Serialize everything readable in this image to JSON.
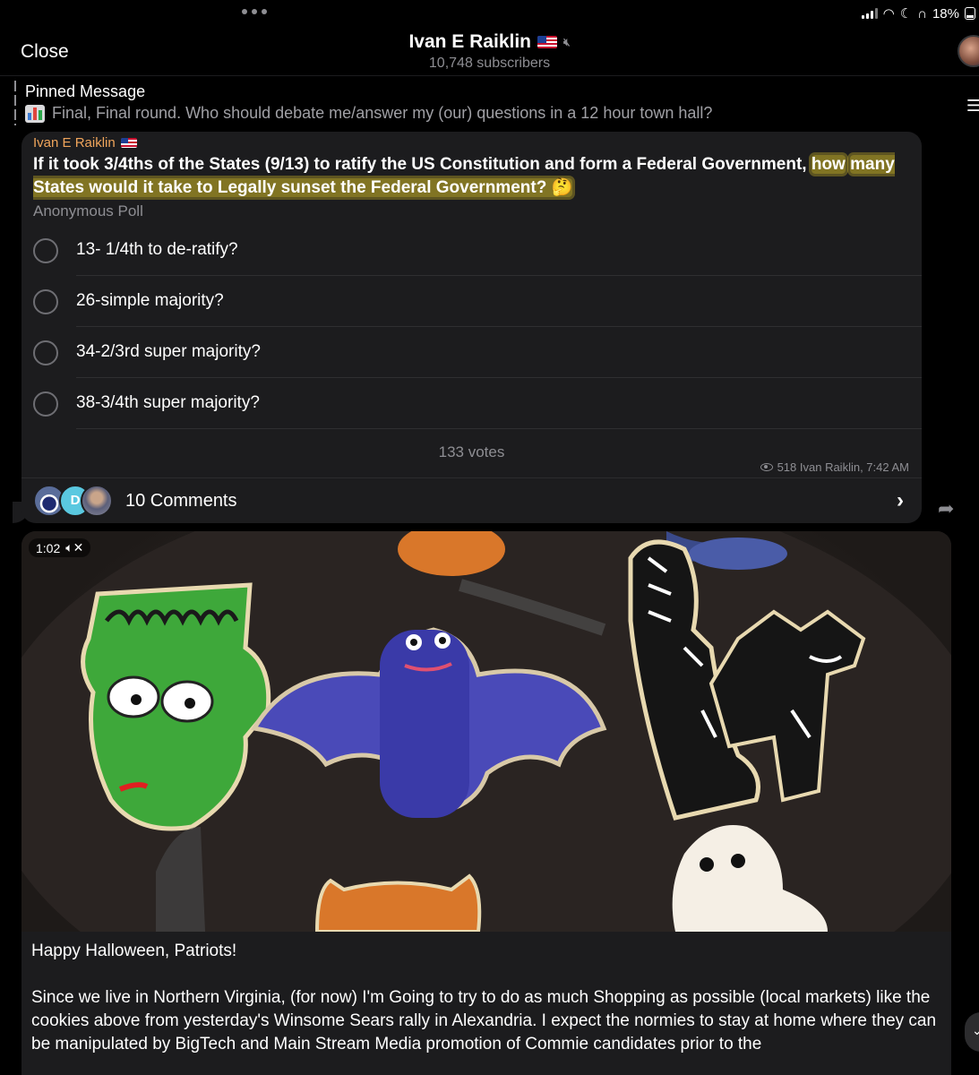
{
  "status": {
    "battery": "18%"
  },
  "header": {
    "close_label": "Close",
    "channel_name": "Ivan E Raiklin",
    "subscribers": "10,748 subscribers"
  },
  "pinned": {
    "title": "Pinned Message",
    "text": "Final, Final round.  Who should debate me/answer my (our) questions in a 12 hour town hall?"
  },
  "poll": {
    "author": "Ivan E Raiklin",
    "question_part1": "If it took 3/4ths of the States (9/13) to ratify the US Constitution and form a Federal Government, ",
    "question_highlight1": "how",
    "question_highlight2": "many States would it take to Legally sunset the Federal Government?  🤔",
    "type": "Anonymous Poll",
    "options": [
      {
        "label": "13- 1/4th to de-ratify?"
      },
      {
        "label": "26-simple majority?"
      },
      {
        "label": "34-2/3rd super majority?"
      },
      {
        "label": "38-3/4th super majority?"
      }
    ],
    "votes": "133 votes",
    "meta": "518 Ivan Raiklin, 7:42 AM",
    "comments_label": "10 Comments",
    "commenter_initial": "D"
  },
  "video": {
    "duration": "1:02",
    "mute_icon": "speaker-muted-icon"
  },
  "caption": {
    "line1": "Happy Halloween, Patriots!",
    "line2": "Since we live in Northern Virginia, (for now) I'm Going to try to do as much Shopping as possible (local markets) like the cookies above from yesterday's Winsome Sears rally in Alexandria. I expect the normies to stay at home where they can be manipulated by BigTech and Main Stream Media promotion of Commie candidates prior to the"
  },
  "colors": {
    "accent_author": "#f0a55b",
    "highlight": "#d6be28",
    "bubble": "#1c1c1e"
  }
}
